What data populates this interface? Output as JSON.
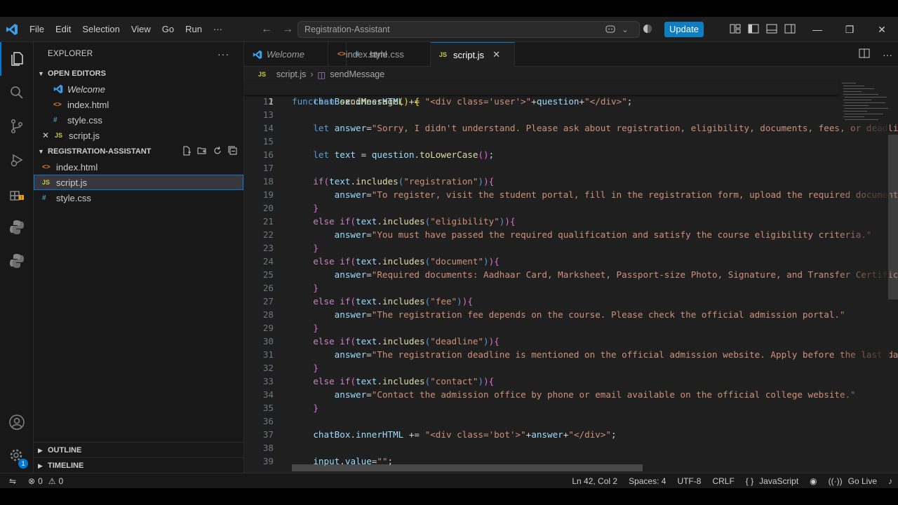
{
  "titlebar": {
    "menus": [
      "File",
      "Edit",
      "Selection",
      "View",
      "Go",
      "Run",
      "···"
    ],
    "command_center": "Registration-Assistant",
    "update_label": "Update"
  },
  "explorer": {
    "title": "EXPLORER",
    "open_editors_label": "OPEN EDITORS",
    "open_editors": [
      {
        "name": "Welcome",
        "icon": "vscode-icon"
      },
      {
        "name": "index.html",
        "icon": "html-icon"
      },
      {
        "name": "style.css",
        "icon": "css-icon"
      },
      {
        "name": "script.js",
        "icon": "js-icon"
      }
    ],
    "project_label": "REGISTRATION-ASSISTANT",
    "files": [
      "index.html",
      "script.js",
      "style.css"
    ],
    "outline_label": "OUTLINE",
    "timeline_label": "TIMELINE"
  },
  "tabs": [
    {
      "label": "Welcome",
      "icon": "vscode-icon"
    },
    {
      "label": "index.html",
      "icon": "html-icon"
    },
    {
      "label": "style.css",
      "icon": "css-icon"
    },
    {
      "label": "script.js",
      "icon": "js-icon"
    }
  ],
  "breadcrumb": {
    "file": "script.js",
    "symbol": "sendMessage"
  },
  "code": {
    "line1_no": "1",
    "line_numbers": [
      "12",
      "13",
      "14",
      "15",
      "16",
      "17",
      "18",
      "19",
      "20",
      "21",
      "22",
      "23",
      "24",
      "25",
      "26",
      "27",
      "28",
      "29",
      "30",
      "31",
      "32",
      "33",
      "34",
      "35",
      "36",
      "37",
      "38",
      "39"
    ],
    "strings": {
      "l12": "\"<div class='user'>\"",
      "l12b": "\"</div>\"",
      "l14": "\"Sorry, I didn't understand. Please ask about registration, eligibility, documents, fees, or deadlines.\"",
      "l18": "\"registration\"",
      "l19": "\"To register, visit the student portal, fill in the registration form, upload the required documents.\"",
      "l21": "\"eligibility\"",
      "l22": "\"You must have passed the required qualification and satisfy the course eligibility criteria.\"",
      "l24": "\"document\"",
      "l25": "\"Required documents: Aadhaar Card, Marksheet, Passport-size Photo, Signature, and Transfer Certificate.\"",
      "l27": "\"fee\"",
      "l28": "\"The registration fee depends on the course. Please check the official admission portal.\"",
      "l30": "\"deadline\"",
      "l31": "\"The registration deadline is mentioned on the official admission website. Apply before the last date.\"",
      "l33": "\"contact\"",
      "l34": "\"Contact the admission office by phone or email available on the official college website.\"",
      "l37": "\"<div class='bot'>\"",
      "l37b": "\"</div>\"",
      "l39": "\"\""
    }
  },
  "status": {
    "errors": "0",
    "warnings": "0",
    "position": "Ln 42, Col 2",
    "spaces": "Spaces: 4",
    "encoding": "UTF-8",
    "eol": "CRLF",
    "language": "JavaScript",
    "golive": "Go Live",
    "badge": "1"
  }
}
